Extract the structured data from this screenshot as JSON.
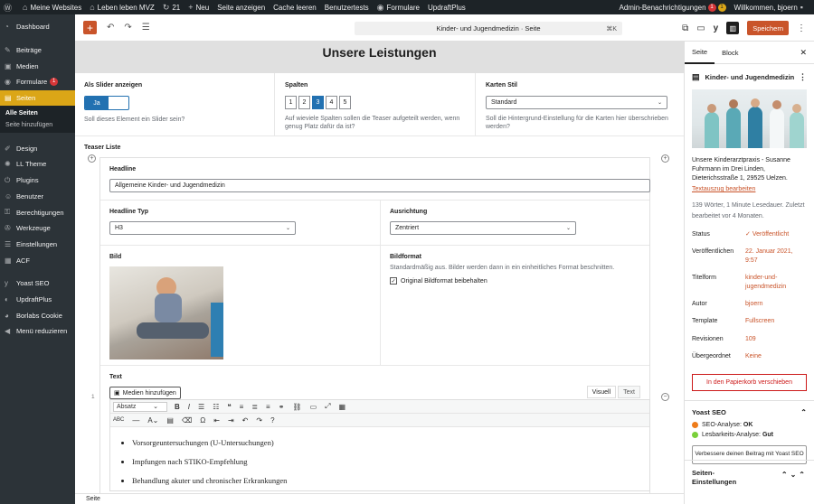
{
  "adminbar": {
    "sites": "Meine Websites",
    "site": "Leben leben MVZ",
    "updates": "21",
    "new": "Neu",
    "view_page": "Seite anzeigen",
    "clear_cache": "Cache leeren",
    "user_tests": "Benutzertests",
    "forms": "Formulare",
    "updraft": "UpdraftPlus",
    "notifications": "Admin-Benachrichtigungen",
    "notif_count_red": "1",
    "notif_count_orange": "1",
    "welcome": "Willkommen, bjoern"
  },
  "sidebar": {
    "dashboard": "Dashboard",
    "posts": "Beiträge",
    "media": "Medien",
    "forms": "Formulare",
    "forms_badge": "1",
    "pages": "Seiten",
    "all_pages": "Alle Seiten",
    "add_page": "Seite hinzufügen",
    "design": "Design",
    "ll_theme": "LL Theme",
    "plugins": "Plugins",
    "users": "Benutzer",
    "permissions": "Berechtigungen",
    "tools": "Werkzeuge",
    "settings": "Einstellungen",
    "acf": "ACF",
    "yoast": "Yoast SEO",
    "updraft": "UpdraftPlus",
    "borlabs": "Borlabs Cookie",
    "collapse": "Menü reduzieren"
  },
  "toolbar": {
    "doc_title": "Kinder- und Jugendmedizin · Seite",
    "shortcut": "⌘K",
    "save": "Speichern"
  },
  "block": {
    "heading": "Unsere Leistungen",
    "slider_label": "Als Slider anzeigen",
    "slider_value": "Ja",
    "slider_help": "Soll dieses Element ein Slider sein?",
    "columns_label": "Spalten",
    "columns_help": "Auf wieviele Spalten sollen die Teaser aufgeteilt werden, wenn genug Platz dafür da ist?",
    "column_options": [
      "1",
      "2",
      "3",
      "4",
      "5"
    ],
    "card_label": "Karten Stil",
    "card_value": "Standard",
    "card_help": "Soll die Hintergrund-Einstellung für die Karten hier überschrieben werden?",
    "teaser_list_label": "Teaser Liste",
    "headline_label": "Headline",
    "headline_value": "Allgemeine Kinder- und Jugendmedizin",
    "headline_type_label": "Headline Typ",
    "headline_type_value": "H3",
    "alignment_label": "Ausrichtung",
    "alignment_value": "Zentriert",
    "image_label": "Bild",
    "image_format_label": "Bildformat",
    "image_format_help": "Standardmäßig aus. Bilder werden dann in ein einheitliches Format beschnitten.",
    "keep_format": "Original Bildformat beibehalten",
    "text_label": "Text",
    "add_media": "Medien hinzufügen",
    "tab_visual": "Visuell",
    "tab_text": "Text",
    "format_select": "Absatz",
    "list_items": [
      "Vorsorgeuntersuchungen (U-Untersuchungen)",
      "Impfungen nach STIKO-Empfehlung",
      "Behandlung akuter und chronischer Erkrankungen"
    ],
    "row_number": "1"
  },
  "breadcrumb": "Seite",
  "panel": {
    "tab_page": "Seite",
    "tab_block": "Block",
    "page_title": "Kinder- und Jugendmedizin",
    "excerpt": "Unsere Kinderarztpraxis - Susanne Fuhrmann im Drei Linden, Dieterichsstraße 1, 29525 Uelzen.",
    "edit_excerpt": "Textauszug bearbeiten",
    "meta": "139 Wörter, 1 Minute Lesedauer. Zuletzt bearbeitet vor 4 Monaten.",
    "status_label": "Status",
    "status_value": "Veröffentlicht",
    "publish_label": "Veröffentlichen",
    "publish_value": "22. Januar 2021, 9:57",
    "slug_label": "Titelform",
    "slug_value": "kinder-und-jugendmedizin",
    "author_label": "Autor",
    "author_value": "bjoern",
    "template_label": "Template",
    "template_value": "Fullscreen",
    "revisions_label": "Revisionen",
    "revisions_value": "109",
    "parent_label": "Übergeordnet",
    "parent_value": "Keine",
    "trash": "In den Papierkorb verschieben",
    "yoast_title": "Yoast SEO",
    "seo_label": "SEO-Analyse:",
    "seo_value": "OK",
    "read_label": "Lesbarkeits-Analyse:",
    "read_value": "Gut",
    "improve": "Verbessere deinen Beitrag mit Yoast SEO",
    "page_settings": "Seiten-Einstellungen"
  },
  "colors": {
    "accent": "#c9542a",
    "wp_blue": "#2271b1",
    "menu_active": "#dba617",
    "seo_ok": "#ee7c1b",
    "read_good": "#7ad03a"
  }
}
